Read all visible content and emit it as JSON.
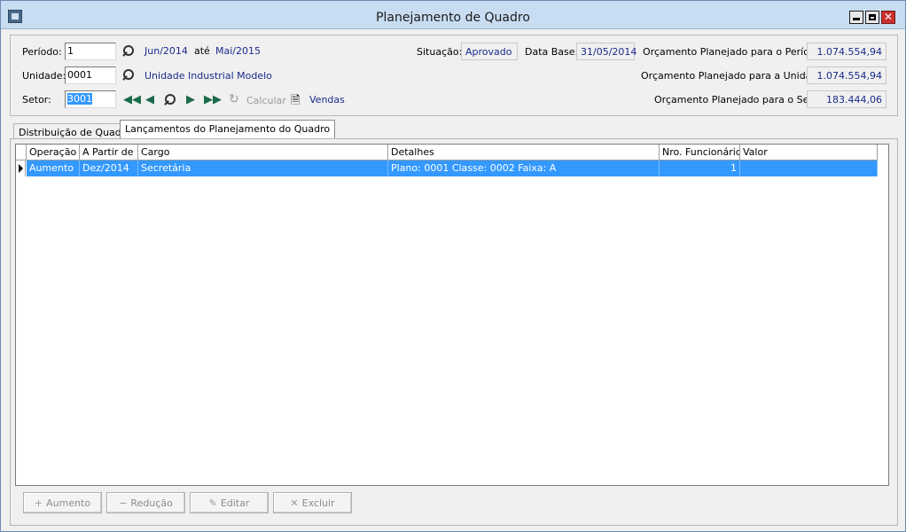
{
  "window": {
    "title": "Planejamento de Quadro",
    "minimize_glyph": "",
    "close_glyph": "✕"
  },
  "header": {
    "periodo_label": "Período:",
    "periodo_value": "1",
    "periodo_inicio": "Jun/2014",
    "ate_label": "até",
    "periodo_fim": "Mai/2015",
    "unidade_label": "Unidade:",
    "unidade_value": "0001",
    "unidade_nome": "Unidade Industrial Modelo",
    "setor_label": "Setor:",
    "setor_value": "3001",
    "calcular_label": "Calcular",
    "vendas_label": "Vendas",
    "situacao_label": "Situação:",
    "situacao_value": "Aprovado",
    "data_base_label": "Data Base:",
    "data_base_value": "31/05/2014",
    "orc_periodo_label": "Orçamento Planejado para o Período:",
    "orc_periodo_value": "1.074.554,94",
    "orc_unidade_label": "Orçamento Planejado para a Unidade:",
    "orc_unidade_value": "1.074.554,94",
    "orc_setor_label": "Orçamento Planejado para o Setor:",
    "orc_setor_value": "183.444,06"
  },
  "tabs": [
    {
      "label": "Distribuição de Quadro"
    },
    {
      "label": "Lançamentos do Planejamento do Quadro"
    }
  ],
  "grid": {
    "columns": [
      "Operação",
      "A Partir de",
      "Cargo",
      "Detalhes",
      "Nro. Funcionários",
      "Valor"
    ],
    "rows": [
      {
        "operacao": "Aumento",
        "a_partir_de": "Dez/2014",
        "cargo": "Secretária",
        "detalhes": "Plano: 0001 Classe: 0002 Faixa: A",
        "nro_funcionarios": "1",
        "valor": ""
      }
    ]
  },
  "buttons": {
    "aumento": "Aumento",
    "reducao": "Redução",
    "editar": "Editar",
    "excluir": "Excluir"
  },
  "colors": {
    "titlebar": "#c8ddf2",
    "selection": "#3399ff",
    "link_text": "#1a2b8c",
    "nav_arrows": "#1b6b4b"
  }
}
